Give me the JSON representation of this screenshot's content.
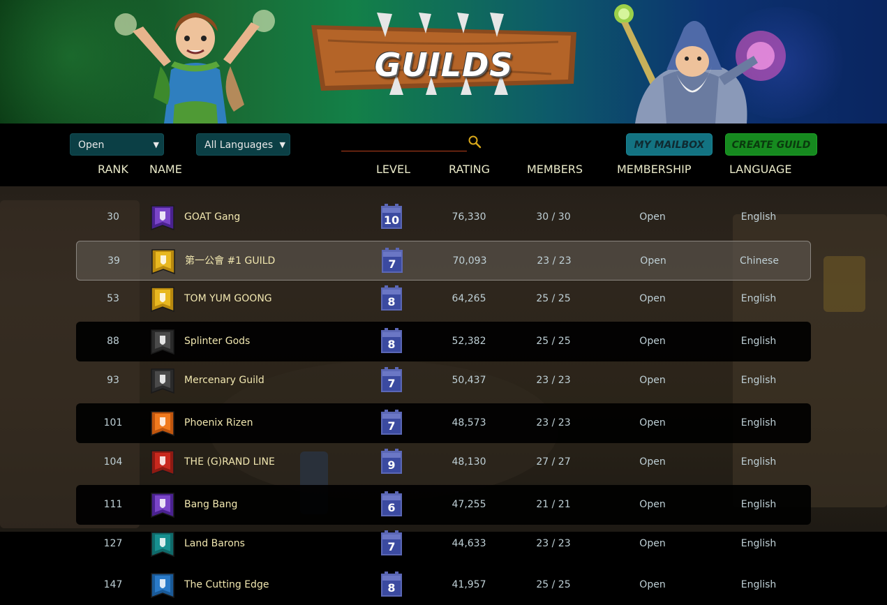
{
  "banner": {
    "title": "GUILDS"
  },
  "filters": {
    "membership_select": "Open",
    "language_select": "All Languages",
    "search": {
      "value": "",
      "placeholder": ""
    }
  },
  "buttons": {
    "mailbox": "MY MAILBOX",
    "create": "CREATE GUILD"
  },
  "columns": {
    "rank": "RANK",
    "name": "NAME",
    "level": "LEVEL",
    "rating": "RATING",
    "members": "MEMBERS",
    "membership": "MEMBERSHIP",
    "language": "LANGUAGE"
  },
  "colors": {
    "name_text": "#f1e7b0",
    "value_text": "#bfd0d6",
    "header_text": "#eaeac9",
    "level_badge": "#3b4aa0",
    "mailbox_button": "#137382",
    "create_button": "#168a1f"
  },
  "guilds": [
    {
      "rank": "30",
      "name": "GOAT Gang",
      "emblem": "purple-hand-emblem",
      "level": "10",
      "rating": "76,330",
      "members": "30 / 30",
      "membership": "Open",
      "language": "English"
    },
    {
      "rank": "39",
      "name": "第一公會 #1 GUILD",
      "emblem": "gold-hand-emblem",
      "level": "7",
      "rating": "70,093",
      "members": "23 / 23",
      "membership": "Open",
      "language": "Chinese"
    },
    {
      "rank": "53",
      "name": "TOM YUM GOONG",
      "emblem": "gold-sword-emblem",
      "level": "8",
      "rating": "64,265",
      "members": "25 / 25",
      "membership": "Open",
      "language": "English"
    },
    {
      "rank": "88",
      "name": "Splinter Gods",
      "emblem": "dark-skull-emblem",
      "level": "8",
      "rating": "52,382",
      "members": "25 / 25",
      "membership": "Open",
      "language": "English"
    },
    {
      "rank": "93",
      "name": "Mercenary Guild",
      "emblem": "dark-shield-emblem",
      "level": "7",
      "rating": "50,437",
      "members": "23 / 23",
      "membership": "Open",
      "language": "English"
    },
    {
      "rank": "101",
      "name": "Phoenix Rizen",
      "emblem": "orange-key-emblem",
      "level": "7",
      "rating": "48,573",
      "members": "23 / 23",
      "membership": "Open",
      "language": "English"
    },
    {
      "rank": "104",
      "name": "THE (G)RAND LINE",
      "emblem": "red-sword-emblem",
      "level": "9",
      "rating": "48,130",
      "members": "27 / 27",
      "membership": "Open",
      "language": "English"
    },
    {
      "rank": "111",
      "name": "Bang Bang",
      "emblem": "purple-hand-emblem",
      "level": "6",
      "rating": "47,255",
      "members": "21 / 21",
      "membership": "Open",
      "language": "English"
    },
    {
      "rank": "127",
      "name": "Land Barons",
      "emblem": "teal-tree-emblem",
      "level": "7",
      "rating": "44,633",
      "members": "23 / 23",
      "membership": "Open",
      "language": "English"
    },
    {
      "rank": "147",
      "name": "The Cutting Edge",
      "emblem": "blue-sword-emblem",
      "level": "8",
      "rating": "41,957",
      "members": "25 / 25",
      "membership": "Open",
      "language": "English"
    }
  ]
}
